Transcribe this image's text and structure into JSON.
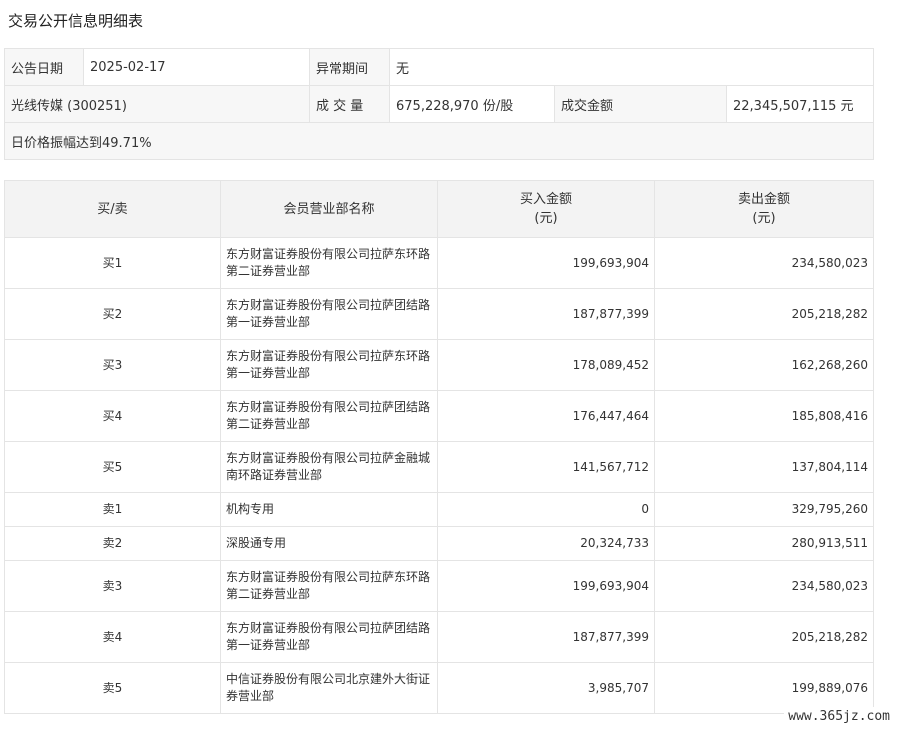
{
  "page": {
    "title": "交易公开信息明细表"
  },
  "info": {
    "announce_date_label": "公告日期",
    "announce_date_value": "2025-02-17",
    "abnormal_period_label": "异常期间",
    "abnormal_period_value": "无",
    "stock_label": "光线传媒 (300251)",
    "volume_label": "成 交 量",
    "volume_value": "675,228,970 份/股",
    "turnover_label": "成交金额",
    "turnover_value": "22,345,507,115 元",
    "reason": "日价格振幅达到49.71%"
  },
  "table": {
    "headers": {
      "side": "买/卖",
      "branch": "会员营业部名称",
      "buy_amount": "买入金额",
      "buy_unit": "(元)",
      "sell_amount": "卖出金额",
      "sell_unit": "(元)"
    },
    "rows": [
      {
        "side": "买1",
        "branch": "东方财富证券股份有限公司拉萨东环路第二证券营业部",
        "buy": "199,693,904",
        "sell": "234,580,023"
      },
      {
        "side": "买2",
        "branch": "东方财富证券股份有限公司拉萨团结路第一证券营业部",
        "buy": "187,877,399",
        "sell": "205,218,282"
      },
      {
        "side": "买3",
        "branch": "东方财富证券股份有限公司拉萨东环路第一证券营业部",
        "buy": "178,089,452",
        "sell": "162,268,260"
      },
      {
        "side": "买4",
        "branch": "东方财富证券股份有限公司拉萨团结路第二证券营业部",
        "buy": "176,447,464",
        "sell": "185,808,416"
      },
      {
        "side": "买5",
        "branch": "东方财富证券股份有限公司拉萨金融城南环路证券营业部",
        "buy": "141,567,712",
        "sell": "137,804,114"
      },
      {
        "side": "卖1",
        "branch": "机构专用",
        "buy": "0",
        "sell": "329,795,260"
      },
      {
        "side": "卖2",
        "branch": "深股通专用",
        "buy": "20,324,733",
        "sell": "280,913,511"
      },
      {
        "side": "卖3",
        "branch": "东方财富证券股份有限公司拉萨东环路第二证券营业部",
        "buy": "199,693,904",
        "sell": "234,580,023"
      },
      {
        "side": "卖4",
        "branch": "东方财富证券股份有限公司拉萨团结路第一证券营业部",
        "buy": "187,877,399",
        "sell": "205,218,282"
      },
      {
        "side": "卖5",
        "branch": "中信证券股份有限公司北京建外大街证券营业部",
        "buy": "3,985,707",
        "sell": "199,889,076"
      }
    ]
  },
  "watermark": "www.365jz.com"
}
